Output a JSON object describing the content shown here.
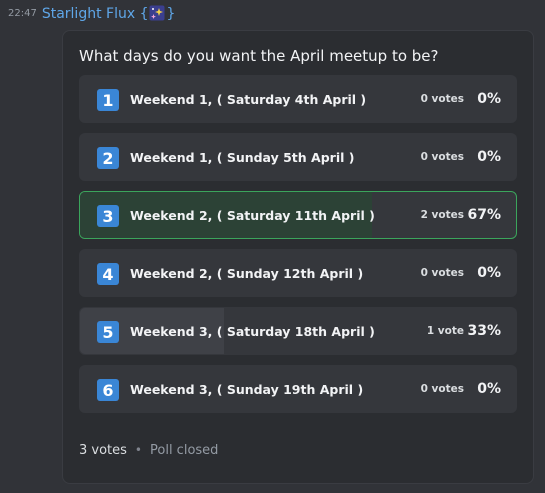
{
  "message": {
    "timestamp": "22:47",
    "username": "Starlight Flux {",
    "username_suffix": "}",
    "username_icon": "sparkle-emoji-icon"
  },
  "poll": {
    "question": "What days do you want the April meetup to be?",
    "answers": [
      {
        "number": "1",
        "label": "Weekend 1, ( Saturday 4th April )",
        "votes": "0 votes",
        "percent": "0%",
        "share": 0,
        "voted": false
      },
      {
        "number": "2",
        "label": "Weekend 1, ( Sunday 5th April )",
        "votes": "0 votes",
        "percent": "0%",
        "share": 0,
        "voted": false
      },
      {
        "number": "3",
        "label": "Weekend 2, ( Saturday 11th April )",
        "votes": "2 votes",
        "percent": "67%",
        "share": 0.67,
        "voted": true
      },
      {
        "number": "4",
        "label": "Weekend 2, ( Sunday 12th April )",
        "votes": "0 votes",
        "percent": "0%",
        "share": 0,
        "voted": false
      },
      {
        "number": "5",
        "label": "Weekend 3, ( Saturday 18th April )",
        "votes": "1 vote",
        "percent": "33%",
        "share": 0.33,
        "voted": false
      },
      {
        "number": "6",
        "label": "Weekend 3, ( Sunday 19th April )",
        "votes": "0 votes",
        "percent": "0%",
        "share": 0,
        "voted": false
      }
    ],
    "total_votes": "3 votes",
    "separator": "•",
    "status": "Poll closed"
  },
  "colors": {
    "background": "#313338",
    "poll_background": "#2b2d31",
    "number_badge": "#3a86d6",
    "voted_border": "#3ba55c",
    "voted_fill": "#2c4236",
    "username": "#5fa7e9"
  }
}
